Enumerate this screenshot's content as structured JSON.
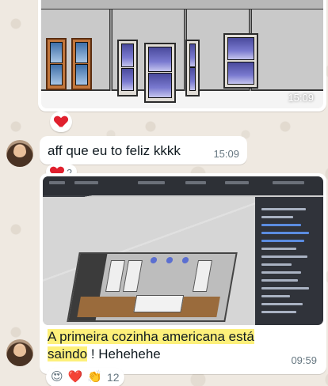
{
  "messages": [
    {
      "type": "image",
      "time": "15:09",
      "reactions": {
        "emojis": [
          "heart"
        ],
        "count": ""
      }
    },
    {
      "type": "text",
      "text": "aff que eu to feliz kkkk",
      "time": "15:09",
      "reactions": {
        "emojis": [
          "heart"
        ],
        "count": "2"
      }
    },
    {
      "type": "image_with_caption",
      "caption_highlight_1": "A primeira cozinha americana está",
      "caption_highlight_2": "saindo",
      "caption_rest": " ! Hehehehe",
      "time": "09:59",
      "reactions": {
        "emojis": [
          "😍",
          "❤️",
          "👏"
        ],
        "count": "12"
      }
    }
  ],
  "colors": {
    "bubble": "#ffffff",
    "wallpaper": "#efe9e1",
    "highlight": "#fdf07a",
    "time_text": "#667781",
    "heart": "#e0202e"
  },
  "icons": [
    "heart-icon",
    "face-with-hearts-emoji",
    "red-heart-emoji",
    "clapping-hands-emoji"
  ]
}
